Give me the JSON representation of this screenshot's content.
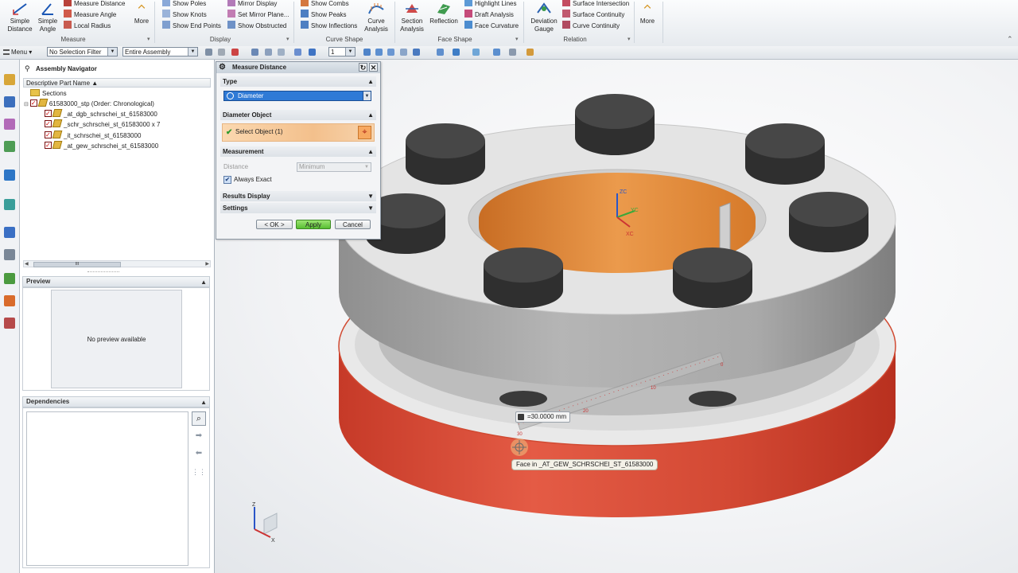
{
  "ribbon": {
    "measure": {
      "simple_distance": "Simple\nDistance",
      "simple_angle": "Simple\nAngle",
      "measure_distance": "Measure Distance",
      "measure_angle": "Measure Angle",
      "local_radius": "Local Radius",
      "more": "More",
      "group": "Measure"
    },
    "display": {
      "show_poles": "Show Poles",
      "show_knots": "Show Knots",
      "show_end_points": "Show End Points",
      "mirror_display": "Mirror Display",
      "set_mirror_plane": "Set Mirror Plane...",
      "show_obstructed": "Show Obstructed",
      "group": "Display"
    },
    "curve_shape": {
      "show_combs": "Show Combs",
      "show_peaks": "Show Peaks",
      "show_inflections": "Show Inflections",
      "curve_analysis": "Curve\nAnalysis",
      "group": "Curve Shape"
    },
    "face_shape": {
      "section_analysis": "Section\nAnalysis",
      "reflection": "Reflection",
      "highlight_lines": "Highlight Lines",
      "draft_analysis": "Draft Analysis",
      "face_curvature": "Face Curvature",
      "group": "Face Shape"
    },
    "relation": {
      "deviation_gauge": "Deviation\nGauge",
      "surface_intersection": "Surface Intersection",
      "surface_continuity": "Surface Continuity",
      "curve_continuity": "Curve Continuity",
      "more": "More",
      "group": "Relation"
    }
  },
  "toolbar": {
    "menu": "Menu",
    "selection_filter": "No Selection Filter",
    "assembly_scope": "Entire Assembly",
    "count": "1"
  },
  "navigator": {
    "title": "Assembly Navigator",
    "column": "Descriptive Part Name",
    "sections": "Sections",
    "root": "61583000_stp (Order: Chronological)",
    "children": [
      "_at_dgb_schrschei_st_61583000",
      "_schr_schrschei_st_61583000 x 7",
      "_it_schrschei_st_61583000",
      "_at_gew_schrschei_st_61583000"
    ],
    "scroll_grip": "III"
  },
  "preview": {
    "title": "Preview",
    "empty": "No preview available"
  },
  "dependencies": {
    "title": "Dependencies"
  },
  "dialog": {
    "title": "Measure Distance",
    "type_label": "Type",
    "type_value": "Diameter",
    "diameter_object": "Diameter Object",
    "select_object": "Select Object (1)",
    "measurement": "Measurement",
    "distance_label": "Distance",
    "distance_value": "Minimum",
    "always_exact": "Always Exact",
    "results_display": "Results Display",
    "settings": "Settings",
    "ok": "< OK >",
    "apply": "Apply",
    "cancel": "Cancel"
  },
  "viewport": {
    "measurement_value": "=30.0000 mm",
    "face_tooltip": "Face in _AT_GEW_SCHRSCHEI_ST_61583000",
    "axis_zc": "ZC",
    "axis_yc": "YC",
    "axis_xc": "XC",
    "triad_z": "Z",
    "triad_x": "X",
    "ruler_ticks": [
      "0",
      "10",
      "20",
      "30"
    ]
  },
  "colors": {
    "highlight_face": "#d14a32",
    "inner_face": "#e2893a",
    "bolt": "#3b3b3b",
    "disk": "#c9c9c9",
    "apply_green": "#6ccf42"
  }
}
